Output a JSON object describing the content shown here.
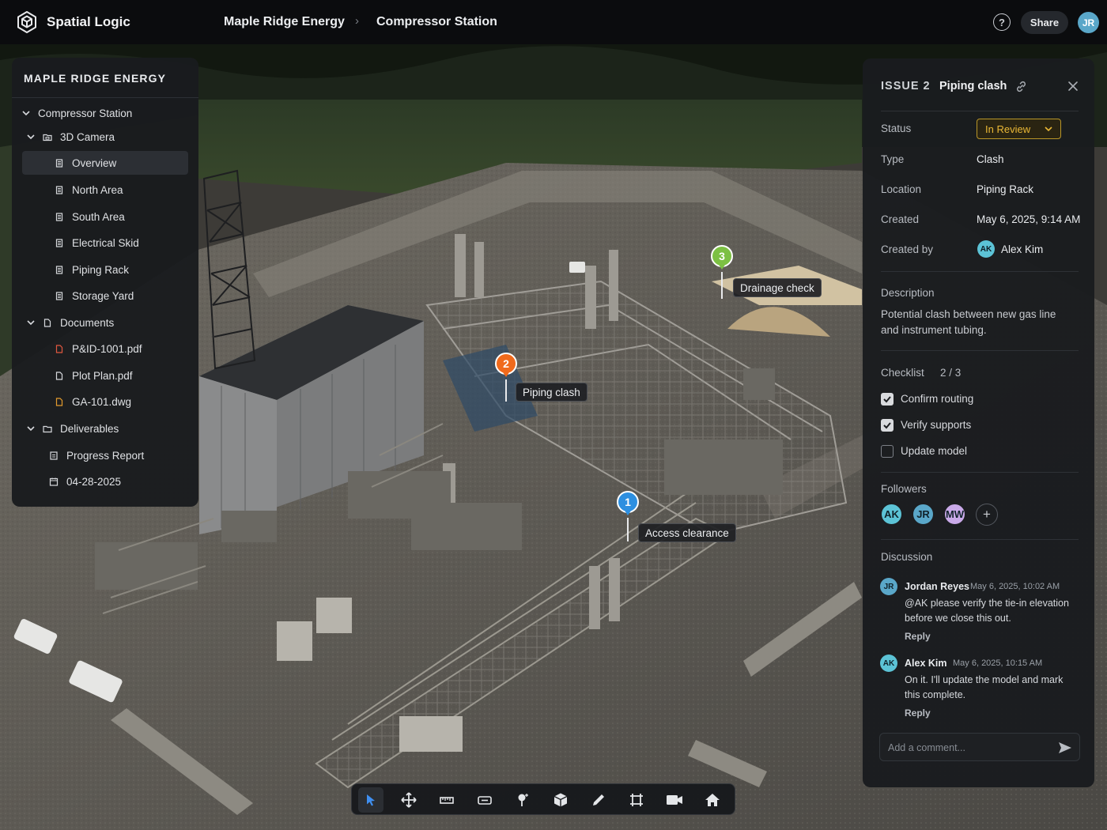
{
  "app": {
    "brand": "Spatial Logic",
    "breadcrumb": [
      "Maple Ridge Energy",
      "Compressor Station"
    ],
    "help_glyph": "?",
    "share_label": "Share",
    "user_initials": "JR"
  },
  "tree": {
    "title": "MAPLE RIDGE ENERGY",
    "root": "Compressor Station",
    "groups": [
      {
        "label": "3D Camera",
        "icon": "camera-folder-icon",
        "items": [
          "Overview",
          "North Area",
          "South Area",
          "Electrical Skid",
          "Piping Rack",
          "Storage Yard"
        ],
        "selected": "Overview"
      },
      {
        "label": "Documents",
        "icon": "document-folder-icon",
        "items": [
          "P&ID-1001.pdf",
          "Plot Plan.pdf",
          "GA-101.dwg"
        ]
      },
      {
        "label": "Deliverables",
        "icon": "folder-icon",
        "items": [
          "Progress Report",
          "04-28-2025"
        ]
      }
    ]
  },
  "issue": {
    "label": "ISSUE 2",
    "title": "Piping clash",
    "fields": {
      "status_label": "Status",
      "status_value": "In Review",
      "type_label": "Type",
      "type_value": "Clash",
      "location_label": "Location",
      "location_value": "Piping Rack",
      "created_label": "Created",
      "created_value": "May 6, 2025, 9:14 AM",
      "created_by_label": "Created by",
      "created_by_initials": "AK",
      "created_by_name": "Alex Kim"
    },
    "description_label": "Description",
    "description": "Potential clash between new gas line and instrument tubing.",
    "checklist_label": "Checklist",
    "checklist_count": "2 / 3",
    "checklist": [
      {
        "label": "Confirm routing",
        "checked": true
      },
      {
        "label": "Verify supports",
        "checked": true
      },
      {
        "label": "Update model",
        "checked": false
      }
    ],
    "followers_label": "Followers",
    "followers": [
      "AK",
      "JR",
      "MW"
    ],
    "add_follower_glyph": "+",
    "discussion_label": "Discussion",
    "comments": [
      {
        "initials": "JR",
        "author": "Jordan Reyes",
        "time": "May 6, 2025, 10:02 AM",
        "text": "@AK please verify the tie-in elevation before we close this out.",
        "reply": "Reply"
      },
      {
        "initials": "AK",
        "author": "Alex Kim",
        "time": "May 6, 2025, 10:15 AM",
        "text": "On it. I'll update the model and mark this complete.",
        "reply": "Reply"
      }
    ],
    "comment_placeholder": "Add a comment..."
  },
  "pins": [
    {
      "number": "1",
      "label": "Access clearance",
      "color": "#2d8fe0"
    },
    {
      "number": "2",
      "label": "Piping clash",
      "color": "#f06a1c"
    },
    {
      "number": "3",
      "label": "Drainage check",
      "color": "#7cc043"
    }
  ],
  "colors": {
    "status_accent": "#eab836",
    "avatar_ak": "#5cc3d6",
    "avatar_jr": "#5aa7c9",
    "avatar_mw": "#c9a9e8"
  },
  "toolbar": {
    "tools": [
      "select-tool-icon",
      "move-tool-icon",
      "measure-tool-icon",
      "section-tool-icon",
      "pin-tool-icon",
      "model-tool-icon",
      "markup-tool-icon",
      "crop-tool-icon",
      "camera-tool-icon",
      "home-tool-icon"
    ]
  }
}
